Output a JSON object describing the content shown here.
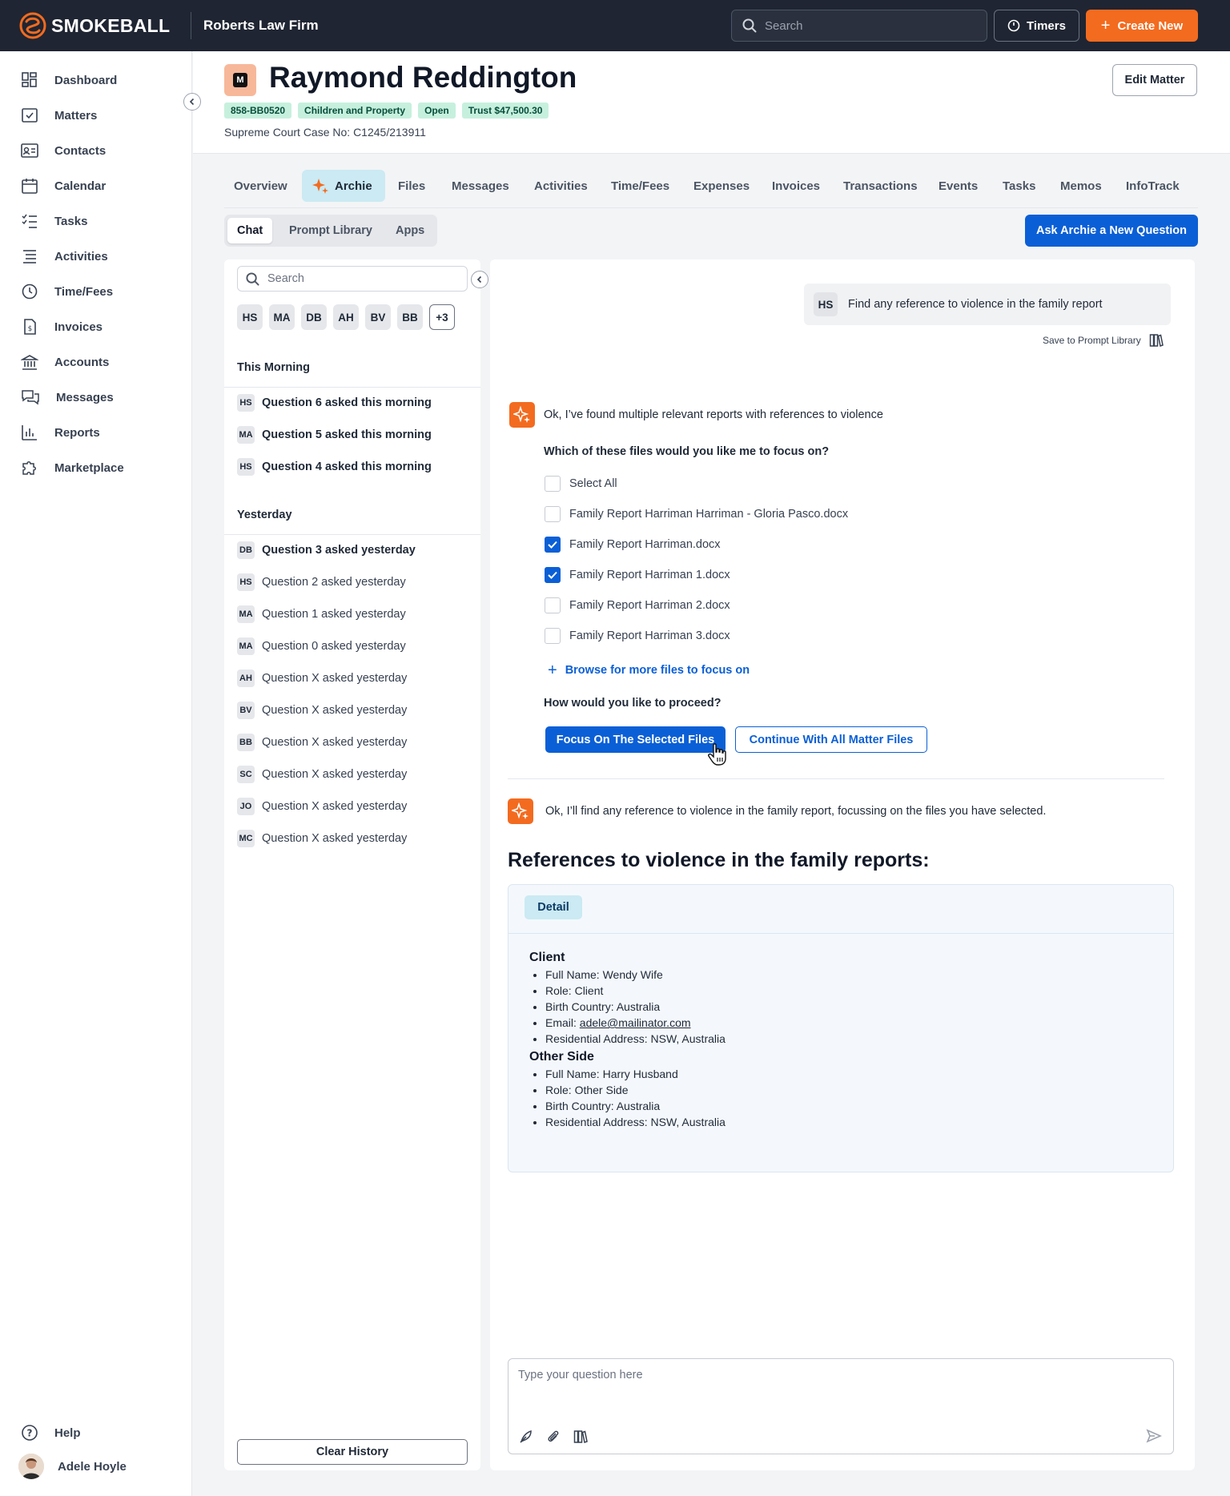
{
  "topbar": {
    "brand": "SMOKEBALL",
    "firm": "Roberts Law Firm",
    "search_placeholder": "Search",
    "timers_label": "Timers",
    "create_label": "Create New"
  },
  "sidebar": {
    "items": [
      {
        "label": "Dashboard",
        "icon": "dashboard-icon"
      },
      {
        "label": "Matters",
        "icon": "matters-icon"
      },
      {
        "label": "Contacts",
        "icon": "contacts-icon"
      },
      {
        "label": "Calendar",
        "icon": "calendar-icon"
      },
      {
        "label": "Tasks",
        "icon": "tasks-icon"
      },
      {
        "label": "Activities",
        "icon": "activities-icon"
      },
      {
        "label": "Time/Fees",
        "icon": "timer-icon"
      },
      {
        "label": "Invoices",
        "icon": "invoice-icon"
      },
      {
        "label": "Accounts",
        "icon": "bank-icon"
      },
      {
        "label": "Messages",
        "icon": "messages-icon"
      },
      {
        "label": "Reports",
        "icon": "reports-icon"
      },
      {
        "label": "Marketplace",
        "icon": "puzzle-icon"
      }
    ],
    "help_label": "Help",
    "user_name": "Adele Hoyle"
  },
  "matter": {
    "icon_letter": "M",
    "title": "Raymond Reddington",
    "badges": [
      "858-BB0520",
      "Children and Property",
      "Open",
      "Trust $47,500.30"
    ],
    "case_no": "Supreme Court Case No: C1245/213911",
    "edit_label": "Edit Matter"
  },
  "tabs": [
    "Overview",
    "Archie",
    "Files",
    "Messages",
    "Activities",
    "Time/Fees",
    "Expenses",
    "Invoices",
    "Transactions",
    "Events",
    "Tasks",
    "Memos",
    "InfoTrack"
  ],
  "active_tab": "Archie",
  "subtabs": [
    "Chat",
    "Prompt Library",
    "Apps"
  ],
  "active_subtab": "Chat",
  "ask_label": "Ask Archie a New Question",
  "history": {
    "search_placeholder": "Search",
    "chips": [
      "HS",
      "MA",
      "DB",
      "AH",
      "BV",
      "BB",
      "+3"
    ],
    "groups": [
      {
        "title": "This Morning",
        "items": [
          {
            "initials": "HS",
            "text": "Question 6 asked this morning",
            "bold": true
          },
          {
            "initials": "MA",
            "text": "Question 5 asked this morning",
            "bold": true
          },
          {
            "initials": "HS",
            "text": "Question 4 asked this morning",
            "bold": true
          }
        ]
      },
      {
        "title": "Yesterday",
        "items": [
          {
            "initials": "DB",
            "text": "Question 3 asked yesterday",
            "bold": true
          },
          {
            "initials": "HS",
            "text": "Question 2 asked yesterday",
            "bold": false
          },
          {
            "initials": "MA",
            "text": "Question 1 asked yesterday",
            "bold": false
          },
          {
            "initials": "MA",
            "text": "Question 0 asked yesterday",
            "bold": false
          },
          {
            "initials": "AH",
            "text": "Question X asked yesterday",
            "bold": false
          },
          {
            "initials": "BV",
            "text": "Question X asked yesterday",
            "bold": false
          },
          {
            "initials": "BB",
            "text": "Question X asked yesterday",
            "bold": false
          },
          {
            "initials": "SC",
            "text": "Question X asked yesterday",
            "bold": false
          },
          {
            "initials": "JO",
            "text": "Question X asked yesterday",
            "bold": false
          },
          {
            "initials": "MC",
            "text": "Question X asked yesterday",
            "bold": false
          }
        ]
      }
    ],
    "clear_label": "Clear History"
  },
  "chat": {
    "user_initials": "HS",
    "user_message": "Find any reference to violence in the family report",
    "save_prompt_label": "Save to Prompt Library",
    "reply1": "Ok, I’ve found multiple relevant reports with references to violence",
    "focus_question": "Which of these files would you like me to focus on?",
    "files": [
      {
        "label": "Select All",
        "checked": false
      },
      {
        "label": "Family Report Harriman Harriman - Gloria Pasco.docx",
        "checked": false
      },
      {
        "label": "Family Report Harriman.docx",
        "checked": true
      },
      {
        "label": "Family Report Harriman 1.docx",
        "checked": true
      },
      {
        "label": "Family Report Harriman 2.docx",
        "checked": false
      },
      {
        "label": "Family Report Harriman 3.docx",
        "checked": false
      }
    ],
    "browse_label": "Browse for more files to focus on",
    "proceed_question": "How would you like to proceed?",
    "focus_button": "Focus On The Selected Files",
    "continue_button": "Continue With All Matter Files",
    "reply2": "Ok, I’ll find any reference to violence in the family report, focussing on the files you have selected.",
    "refs_title": "References to violence in the family reports:",
    "detail_tab": "Detail",
    "sections": [
      {
        "title": "Client",
        "items": [
          {
            "prefix": "Full Name: ",
            "value": "Wendy Wife"
          },
          {
            "prefix": "Role: ",
            "value": "Client"
          },
          {
            "prefix": "Birth Country: ",
            "value": "Australia"
          },
          {
            "prefix": "Email: ",
            "value": "adele@mailinator.com",
            "link": true
          },
          {
            "prefix": "Residential Address: ",
            "value": "NSW, Australia"
          }
        ]
      },
      {
        "title": "Other Side",
        "items": [
          {
            "prefix": "Full Name: ",
            "value": "Harry Husband"
          },
          {
            "prefix": "Role: ",
            "value": "Other Side"
          },
          {
            "prefix": "Birth Country: ",
            "value": "Australia"
          },
          {
            "prefix": "Residential Address: ",
            "value": "NSW, Australia"
          }
        ]
      }
    ],
    "input_placeholder": "Type your question here"
  },
  "colors": {
    "brand_orange": "#f36b1f",
    "primary_blue": "#0b5fd6",
    "topbar_bg": "#1f2532",
    "badge_green": "#c6f0dd",
    "active_tab_bg": "#cbeaf3"
  }
}
